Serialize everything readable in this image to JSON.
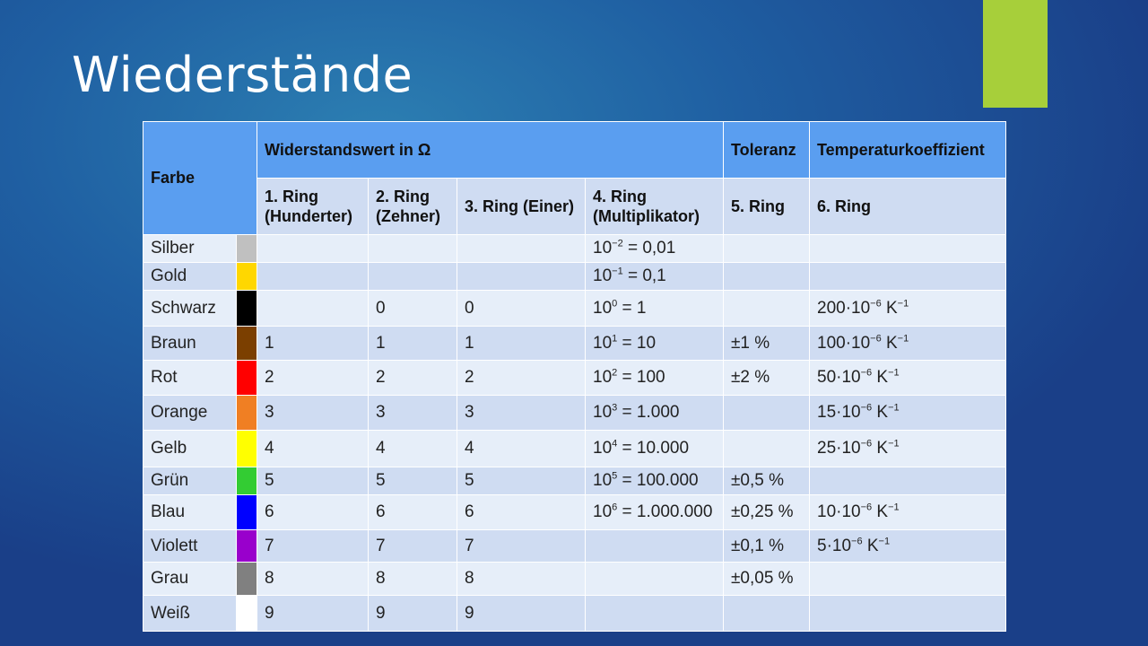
{
  "slide": {
    "title": "Wiederstände"
  },
  "colors": {
    "accent": "#a7cf3a",
    "header_bg": "#5a9ef0"
  },
  "table": {
    "header": {
      "farbe": "Farbe",
      "widerstandswert": "Widerstandswert in Ω",
      "toleranz": "Toleranz",
      "temperatur": "Temperaturkoeffizient"
    },
    "subheader": {
      "ring1_a": "1. Ring",
      "ring1_b": "(Hunderter)",
      "ring2_a": "2. Ring",
      "ring2_b": "(Zehner)",
      "ring3": "3. Ring (Einer)",
      "ring4_a": "4. Ring",
      "ring4_b": "(Multiplikator)",
      "ring5": "5. Ring",
      "ring6": "6. Ring"
    },
    "rows": [
      {
        "name": "Silber",
        "swatch": "#c0c0c0",
        "r1": "",
        "r2": "",
        "r3": "",
        "m_base": "10",
        "m_exp": "−2",
        "m_val": " = 0,01",
        "tol": "",
        "tk_a": "",
        "tk_exp": "",
        "tk_unit": "",
        "tk_unit_exp": ""
      },
      {
        "name": "Gold",
        "swatch": "#ffd700",
        "r1": "",
        "r2": "",
        "r3": "",
        "m_base": "10",
        "m_exp": "−1",
        "m_val": " = 0,1",
        "tol": "",
        "tk_a": "",
        "tk_exp": "",
        "tk_unit": "",
        "tk_unit_exp": ""
      },
      {
        "name": "Schwarz",
        "swatch": "#000000",
        "r1": "",
        "r2": "0",
        "r3": "0",
        "m_base": "10",
        "m_exp": "0",
        "m_val": " = 1",
        "tol": "",
        "tk_a": "200·10",
        "tk_exp": "−6",
        "tk_unit": " K",
        "tk_unit_exp": "−1"
      },
      {
        "name": "Braun",
        "swatch": "#7b3f00",
        "r1": "1",
        "r2": "1",
        "r3": "1",
        "m_base": "10",
        "m_exp": "1",
        "m_val": " = 10",
        "tol": "±1 %",
        "tk_a": "100·10",
        "tk_exp": "−6",
        "tk_unit": " K",
        "tk_unit_exp": "−1"
      },
      {
        "name": "Rot",
        "swatch": "#ff0000",
        "r1": "2",
        "r2": "2",
        "r3": "2",
        "m_base": "10",
        "m_exp": "2",
        "m_val": " = 100",
        "tol": "±2 %",
        "tk_a": "50·10",
        "tk_exp": "−6",
        "tk_unit": " K",
        "tk_unit_exp": "−1"
      },
      {
        "name": "Orange",
        "swatch": "#f07f23",
        "r1": "3",
        "r2": "3",
        "r3": "3",
        "m_base": "10",
        "m_exp": "3",
        "m_val": " = 1.000",
        "tol": "",
        "tk_a": "15·10",
        "tk_exp": "−6",
        "tk_unit": " K",
        "tk_unit_exp": "−1"
      },
      {
        "name": "Gelb",
        "swatch": "#ffff00",
        "r1": "4",
        "r2": "4",
        "r3": "4",
        "m_base": "10",
        "m_exp": "4",
        "m_val": " = 10.000",
        "tol": "",
        "tk_a": "25·10",
        "tk_exp": "−6",
        "tk_unit": " K",
        "tk_unit_exp": "−1"
      },
      {
        "name": "Grün",
        "swatch": "#33cc33",
        "r1": "5",
        "r2": "5",
        "r3": "5",
        "m_base": "10",
        "m_exp": "5",
        "m_val": " = 100.000",
        "tol": "±0,5 %",
        "tk_a": "",
        "tk_exp": "",
        "tk_unit": "",
        "tk_unit_exp": ""
      },
      {
        "name": "Blau",
        "swatch": "#0000ff",
        "r1": "6",
        "r2": "6",
        "r3": "6",
        "m_base": "10",
        "m_exp": "6",
        "m_val": " = 1.000.000",
        "tol": "±0,25 %",
        "tk_a": "10·10",
        "tk_exp": "−6",
        "tk_unit": " K",
        "tk_unit_exp": "−1"
      },
      {
        "name": "Violett",
        "swatch": "#9900cc",
        "r1": "7",
        "r2": "7",
        "r3": "7",
        "m_base": "",
        "m_exp": "",
        "m_val": "",
        "tol": "±0,1 %",
        "tk_a": "5·10",
        "tk_exp": "−6",
        "tk_unit": " K",
        "tk_unit_exp": "−1"
      },
      {
        "name": "Grau",
        "swatch": "#808080",
        "r1": "8",
        "r2": "8",
        "r3": "8",
        "m_base": "",
        "m_exp": "",
        "m_val": "",
        "tol": "±0,05 %",
        "tk_a": "",
        "tk_exp": "",
        "tk_unit": "",
        "tk_unit_exp": ""
      },
      {
        "name": "Weiß",
        "swatch": "#ffffff",
        "r1": "9",
        "r2": "9",
        "r3": "9",
        "m_base": "",
        "m_exp": "",
        "m_val": "",
        "tol": "",
        "tk_a": "",
        "tk_exp": "",
        "tk_unit": "",
        "tk_unit_exp": ""
      }
    ]
  }
}
